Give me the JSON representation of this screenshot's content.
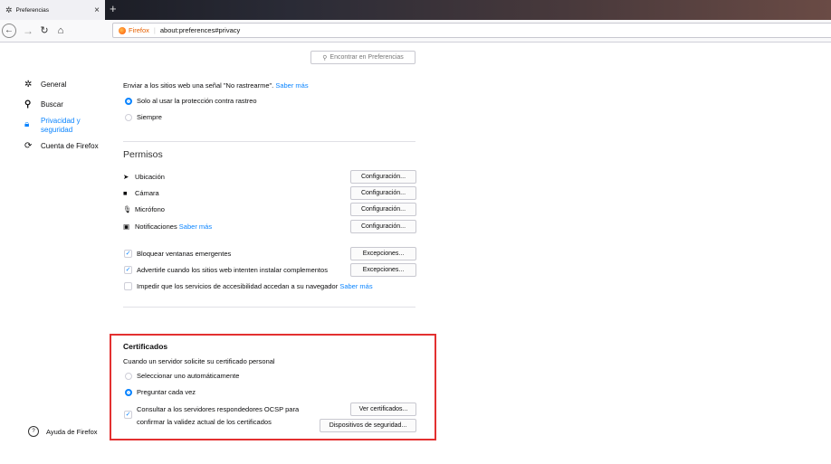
{
  "browser": {
    "tab_title": "Preferencias",
    "tab_close": "×",
    "new_tab": "+",
    "identity": "Firefox",
    "url": "about:preferences#privacy"
  },
  "search": {
    "placeholder": "Encontrar en Preferencias"
  },
  "sidebar": {
    "items": [
      {
        "label": "General",
        "icon": "gear-icon"
      },
      {
        "label": "Buscar",
        "icon": "search-icon"
      },
      {
        "label": "Privacidad y seguridad",
        "icon": "lock-icon"
      },
      {
        "label": "Cuenta de Firefox",
        "icon": "sync-icon"
      }
    ],
    "help": "Ayuda de Firefox"
  },
  "dnt": {
    "text": "Enviar a los sitios web una señal \"No rastrearme\".",
    "link": "Saber más",
    "options": [
      "Solo al usar la protección contra rastreo",
      "Siempre"
    ],
    "selected": 0
  },
  "permissions": {
    "title": "Permisos",
    "items": [
      {
        "label": "Ubicación",
        "icon": "location-arrow-icon",
        "button": "Configuración..."
      },
      {
        "label": "Cámara",
        "icon": "camera-icon",
        "button": "Configuración..."
      },
      {
        "label": "Micrófono",
        "icon": "microphone-icon",
        "button": "Configuración..."
      },
      {
        "label": "Notificaciones",
        "icon": "notification-icon",
        "link": "Saber más",
        "button": "Configuración..."
      }
    ],
    "checks": [
      {
        "label": "Bloquear ventanas emergentes",
        "checked": true,
        "button": "Excepciones..."
      },
      {
        "label": "Advertirle cuando los sitios web intenten instalar complementos",
        "checked": true,
        "button": "Excepciones..."
      },
      {
        "label": "Impedir que los servicios de accesibilidad accedan a su navegador",
        "checked": false,
        "link": "Saber más"
      }
    ]
  },
  "certificates": {
    "title": "Certificados",
    "subtitle": "Cuando un servidor solicite su certificado personal",
    "options": [
      "Seleccionar uno automáticamente",
      "Preguntar cada vez"
    ],
    "selected": 1,
    "ocsp_line1": "Consultar a los servidores respondedores OCSP para",
    "ocsp_line2": "confirmar la validez actual de los certificados",
    "ocsp_checked": true,
    "view_button": "Ver certificados...",
    "devices_button": "Dispositivos de seguridad..."
  },
  "colors": {
    "accent": "#0a84ff",
    "highlight": "#e33030"
  }
}
